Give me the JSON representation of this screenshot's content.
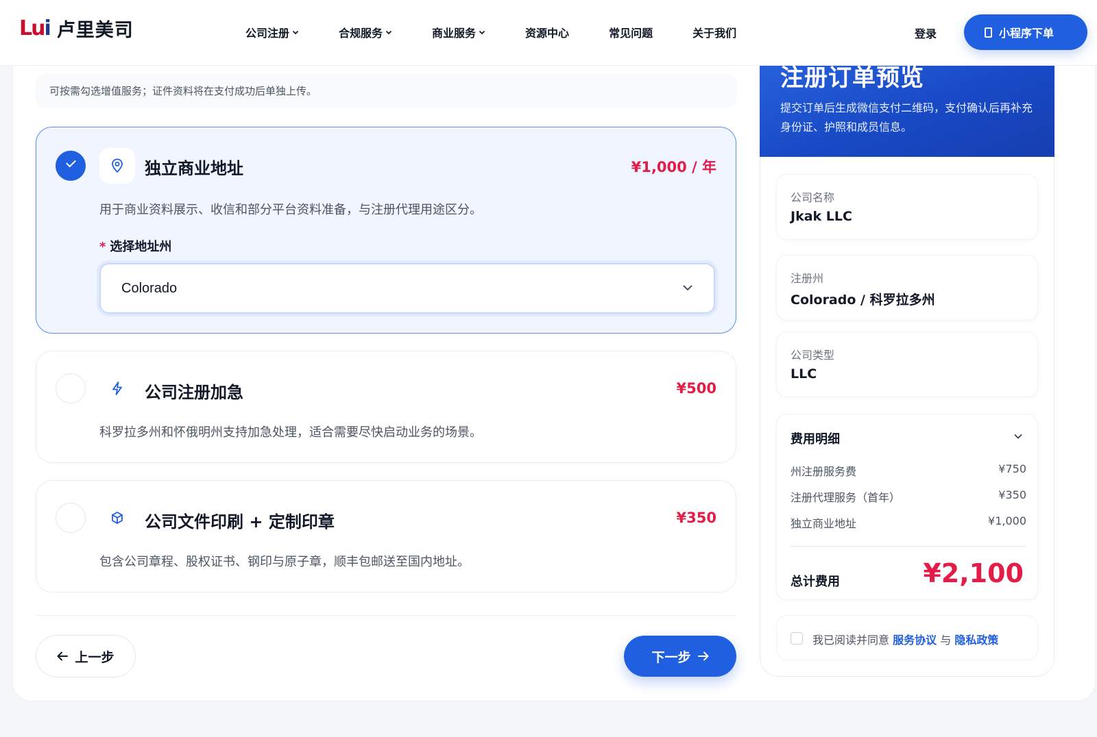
{
  "brand": {
    "mark": "Lui",
    "name": "卢里美司"
  },
  "nav": {
    "items": [
      {
        "label": "公司注册"
      },
      {
        "label": "合规服务"
      },
      {
        "label": "商业服务"
      },
      {
        "label": "资源中心"
      },
      {
        "label": "常见问题"
      },
      {
        "label": "关于我们"
      }
    ],
    "login": "登录",
    "mini_program": "小程序下单"
  },
  "form": {
    "hint": "可按需勾选增值服务；证件资料将在支付成功后单独上传。",
    "options": [
      {
        "title": "独立商业地址",
        "price": "¥1,000 / 年",
        "desc": "用于商业资料展示、收信和部分平台资料准备，与注册代理用途区分。",
        "selected": true,
        "icon": "location-pin-icon",
        "state_label": "选择地址州",
        "state_value": "Colorado"
      },
      {
        "title": "公司注册加急",
        "price": "¥500",
        "desc": "科罗拉多州和怀俄明州支持加急处理，适合需要尽快启动业务的场景。",
        "selected": false,
        "icon": "lightning-icon"
      },
      {
        "title": "公司文件印刷 + 定制印章",
        "price": "¥350",
        "desc": "包含公司章程、股权证书、钢印与原子章，顺丰包邮送至国内地址。",
        "selected": false,
        "icon": "package-icon"
      }
    ],
    "prev": "上一步",
    "next": "下一步"
  },
  "summary": {
    "title": "注册订单预览",
    "subtitle": "提交订单后生成微信支付二维码，支付确认后再补充身份证、护照和成员信息。",
    "company_name_label": "公司名称",
    "company_name": "Jkak LLC",
    "state_label": "注册州",
    "state": "Colorado / 科罗拉多州",
    "type_label": "公司类型",
    "type": "LLC",
    "fees_title": "费用明细",
    "fees": [
      {
        "name": "州注册服务费",
        "amount": "¥750"
      },
      {
        "name": "注册代理服务（首年）",
        "amount": "¥350"
      },
      {
        "name": "独立商业地址",
        "amount": "¥1,000"
      }
    ],
    "total_label": "总计费用",
    "total": "¥2,100",
    "agree_prefix": "我已阅读并同意",
    "agree_terms": "服务协议",
    "agree_and": "与",
    "agree_privacy": "隐私政策"
  },
  "colors": {
    "accent": "#1f5fe0",
    "price": "#e11d48",
    "brand_red": "#c8102e"
  }
}
